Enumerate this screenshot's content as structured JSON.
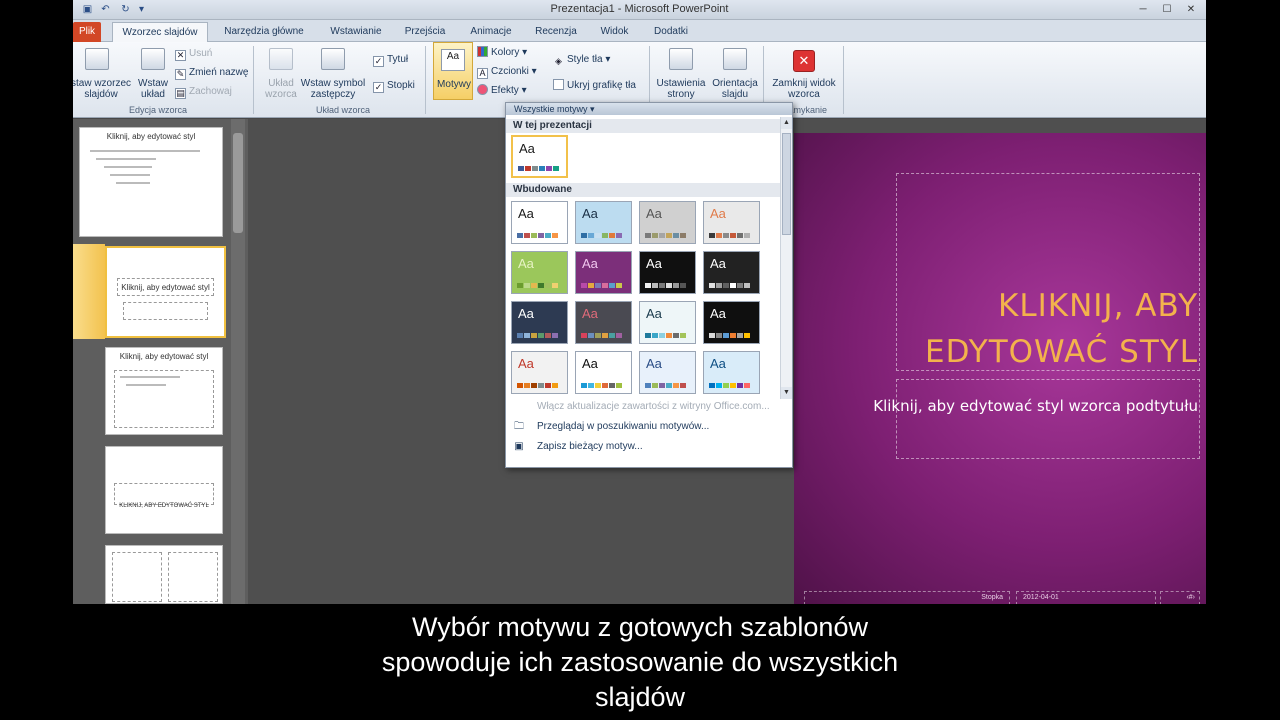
{
  "window": {
    "title": "Prezentacja1 - Microsoft PowerPoint"
  },
  "tabs": [
    {
      "label": "Plik"
    },
    {
      "label": "Wzorzec slajdów"
    },
    {
      "label": "Narzędzia główne"
    },
    {
      "label": "Wstawianie"
    },
    {
      "label": "Przejścia"
    },
    {
      "label": "Animacje"
    },
    {
      "label": "Recenzja"
    },
    {
      "label": "Widok"
    },
    {
      "label": "Dodatki"
    }
  ],
  "ribbon": {
    "edit_master": {
      "insert_master": "stаw wzorzec slajdów",
      "insert_layout": "Wstaw układ",
      "delete": "Usuń",
      "rename": "Zmień nazwę",
      "preserve": "Zachowaj",
      "group_label": "Edycja wzorca"
    },
    "layout": {
      "master_layout": "Układ wzorca",
      "insert_placeholder": "Wstaw symbol zastępczy",
      "title_checkbox": "Tytuł",
      "footers_checkbox": "Stopki",
      "group_label": "Układ wzorca"
    },
    "themes": {
      "themes_button": "Motywy",
      "colors": "Kolory",
      "fonts": "Czcionki",
      "effects": "Efekty",
      "bg_styles": "Style tła",
      "hide_bg": "Ukryj grafikę tła"
    },
    "page_setup": {
      "slide_size": "Ustawienia strony",
      "orientation": "Orientacja slajdu",
      "group_label_partial": "trony"
    },
    "close": {
      "close_master": "Zamknij widok wzorca",
      "group_label": "Zamykanie"
    }
  },
  "thumbnails": {
    "thumb1_title": "Kliknij, aby edytować styl",
    "thumb2_title": "Kliknij, aby edytować styl",
    "thumb3_title": "Kliknij, aby edytować styl",
    "thumb4_title": "KLIKNIJ, ABY EDYTOWAĆ STYL"
  },
  "gallery": {
    "header": "Wszystkie motywy",
    "section_current": "W tej prezentacji",
    "section_builtin": "Wbudowane",
    "theme_label": "Aa",
    "menu_update": "Włącz aktualizacje zawartości z witryny Office.com...",
    "menu_browse": "Przeglądaj w poszukiwaniu motywów...",
    "menu_save": "Zapisz bieżący motyw..."
  },
  "themes": [
    {
      "bg": "#ffffff",
      "fg": "#1a1a1a",
      "sw": [
        "#3b5998",
        "#c0392b",
        "#7f8c8d",
        "#2980b9",
        "#8e44ad",
        "#16a085"
      ]
    },
    {
      "bg": "#ffffff",
      "fg": "#1a1a1a",
      "sw": [
        "#4a6fa5",
        "#c0504d",
        "#9bbb59",
        "#8064a2",
        "#4bacc6",
        "#f79646"
      ]
    },
    {
      "bg": "#bcdcf0",
      "fg": "#1a2f45",
      "sw": [
        "#2f6ea4",
        "#69a8d6",
        "#c9e0f1",
        "#87b663",
        "#e07a3a",
        "#8a6bb2"
      ]
    },
    {
      "bg": "#d0d0d0",
      "fg": "#555555",
      "sw": [
        "#7a7a7a",
        "#9b9b6c",
        "#a5a5a5",
        "#c4a55a",
        "#6b8ea3",
        "#8c7c68"
      ]
    },
    {
      "bg": "#e9e9e9",
      "fg": "#e07b4a",
      "sw": [
        "#3a3a3a",
        "#e07b4a",
        "#8a8a8a",
        "#c55a3a",
        "#70706f",
        "#b0b0b0"
      ]
    },
    {
      "bg": "#9bc75b",
      "fg": "#e7f3c4",
      "sw": [
        "#6b9c2e",
        "#bcd98b",
        "#e3b84f",
        "#3f7a2c",
        "#a0c060",
        "#f0d070"
      ]
    },
    {
      "bg": "#7c2f7a",
      "fg": "#f0c6ee",
      "sw": [
        "#b84aa8",
        "#e3a93f",
        "#7a7ab7",
        "#d86c9c",
        "#5a9fcb",
        "#c9c94a"
      ]
    },
    {
      "bg": "#101010",
      "fg": "#ffffff",
      "sw": [
        "#f0f0f0",
        "#bbbbbb",
        "#777777",
        "#dddddd",
        "#999999",
        "#555555"
      ]
    },
    {
      "bg": "#222222",
      "fg": "#ffffff",
      "sw": [
        "#e0e0e0",
        "#a0a0a0",
        "#606060",
        "#ffffff",
        "#808080",
        "#c0c0c0"
      ]
    },
    {
      "bg": "#2d3a52",
      "fg": "#ffffff",
      "sw": [
        "#5a7fb0",
        "#8fb3d9",
        "#c9a23f",
        "#5c9a6b",
        "#b15a5a",
        "#8c6fb0"
      ]
    },
    {
      "bg": "#4a4a52",
      "fg": "#e06b7a",
      "sw": [
        "#d9425b",
        "#6b8fbf",
        "#9f9f5a",
        "#e0a040",
        "#4aa0a0",
        "#a060a0"
      ]
    },
    {
      "bg": "#eef6f8",
      "fg": "#1a3b4d",
      "sw": [
        "#1f7a9c",
        "#3aa6c8",
        "#8ccfe0",
        "#f08a3a",
        "#6c6c6c",
        "#a3c45a"
      ]
    },
    {
      "bg": "#0f0f0f",
      "fg": "#ffffff",
      "sw": [
        "#d9d9d9",
        "#888888",
        "#5b9bd5",
        "#ed7d31",
        "#a5a5a5",
        "#ffc000"
      ]
    },
    {
      "bg": "#f2f2f2",
      "fg": "#c0392b",
      "sw": [
        "#d35400",
        "#e67e22",
        "#a04000",
        "#7f8c8d",
        "#c0392b",
        "#f39c12"
      ]
    },
    {
      "bg": "#ffffff",
      "fg": "#111111",
      "sw": [
        "#1b9ad6",
        "#3fb6e3",
        "#f0d03c",
        "#e06a3a",
        "#666666",
        "#a0c040"
      ]
    },
    {
      "bg": "#e8f1fb",
      "fg": "#2a4d86",
      "sw": [
        "#4f81bd",
        "#9bbb59",
        "#8064a2",
        "#4bacc6",
        "#f79646",
        "#c0504d"
      ]
    },
    {
      "bg": "#d9ecf9",
      "fg": "#0e4f84",
      "sw": [
        "#0070c0",
        "#00b0f0",
        "#92d050",
        "#ffc000",
        "#7030a0",
        "#ff6666"
      ]
    }
  ],
  "slide": {
    "title": "KLIKNIJ, ABY EDYTOWAĆ STYL",
    "subtitle": "Kliknij, aby edytować styl wzorca podtytułu",
    "footer_text": "Stopka",
    "footer_date": "2012-04-01",
    "footer_num": "‹#›"
  },
  "caption": {
    "line1": "Wybór motywu z gotowych szablonów",
    "line2": "spowoduje ich zastosowanie do wszystkich",
    "line3": "slajdów"
  }
}
